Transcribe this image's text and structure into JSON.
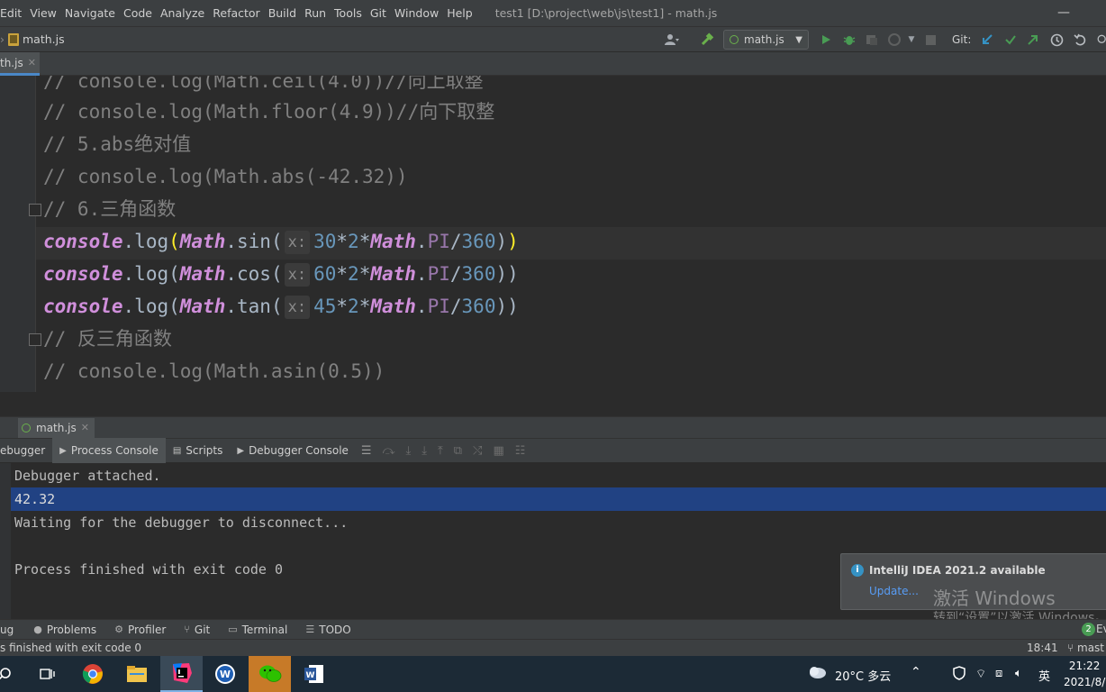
{
  "menu": {
    "items": [
      "Edit",
      "View",
      "Navigate",
      "Code",
      "Analyze",
      "Refactor",
      "Build",
      "Run",
      "Tools",
      "Git",
      "Window",
      "Help"
    ],
    "window_title": "test1 [D:\\project\\web\\js\\test1] - math.js"
  },
  "navbar": {
    "file": "math.js",
    "run_config": "math.js",
    "git_label": "Git:"
  },
  "editor_tab": {
    "label": "th.js"
  },
  "code": {
    "line1": "// console.log(Math.ceil(4.0))//向上取整",
    "line2": "// console.log(Math.floor(4.9))//向下取整",
    "line3": "// 5.abs绝对值",
    "line4": "// console.log(Math.abs(-42.32))",
    "line5": "// 6.三角函数",
    "line6": {
      "obj": "console",
      "dot1": ".",
      "method": "log",
      "open": "(",
      "math": "Math",
      "fn": "sin",
      "hint": "x:",
      "n1": "30",
      "op1": "*",
      "n2": "2",
      "op2": "*",
      "math2": "Math",
      "pi": "PI",
      "div": "/",
      "n3": "360",
      "close1": ")",
      "close2": ")"
    },
    "line7": {
      "obj": "console",
      "dot1": ".",
      "method": "log",
      "open": "(",
      "math": "Math",
      "fn": "cos",
      "hint": "x:",
      "n1": "60",
      "op1": "*",
      "n2": "2",
      "op2": "*",
      "math2": "Math",
      "pi": "PI",
      "div": "/",
      "n3": "360",
      "close": "))"
    },
    "line8": {
      "obj": "console",
      "dot1": ".",
      "method": "log",
      "open": "(",
      "math": "Math",
      "fn": "tan",
      "hint": "x:",
      "n1": "45",
      "op1": "*",
      "n2": "2",
      "op2": "*",
      "math2": "Math",
      "pi": "PI",
      "div": "/",
      "n3": "360",
      "close": "))"
    },
    "line9": "// 反三角函数",
    "line10": "// console.log(Math.asin(0.5))"
  },
  "debug": {
    "file_tab": "math.js",
    "tabs": [
      "ebugger",
      "Process Console",
      "Scripts",
      "Debugger Console"
    ],
    "console_lines": [
      "Debugger attached.",
      "42.32",
      "Waiting for the debugger to disconnect...",
      "",
      "Process finished with exit code 0"
    ]
  },
  "notification": {
    "title": "IntelliJ IDEA 2021.2 available",
    "link": "Update..."
  },
  "watermark": {
    "line1": "激活 Windows",
    "line2": "转到“设置”以激活 Windows。"
  },
  "toolstrip": {
    "items": [
      "ug",
      "Problems",
      "Profiler",
      "Git",
      "Terminal",
      "TODO"
    ],
    "events_count": "2",
    "events_label": "Ev"
  },
  "status": {
    "message": "s finished with exit code 0",
    "position": "18:41",
    "branch": "mast"
  },
  "taskbar": {
    "weather": "20°C 多云",
    "ime": "英",
    "time": "21:22",
    "date": "2021/8/"
  },
  "colors": {
    "selection": "#214283",
    "notif_link": "#589df6",
    "run_green": "#499c54"
  }
}
